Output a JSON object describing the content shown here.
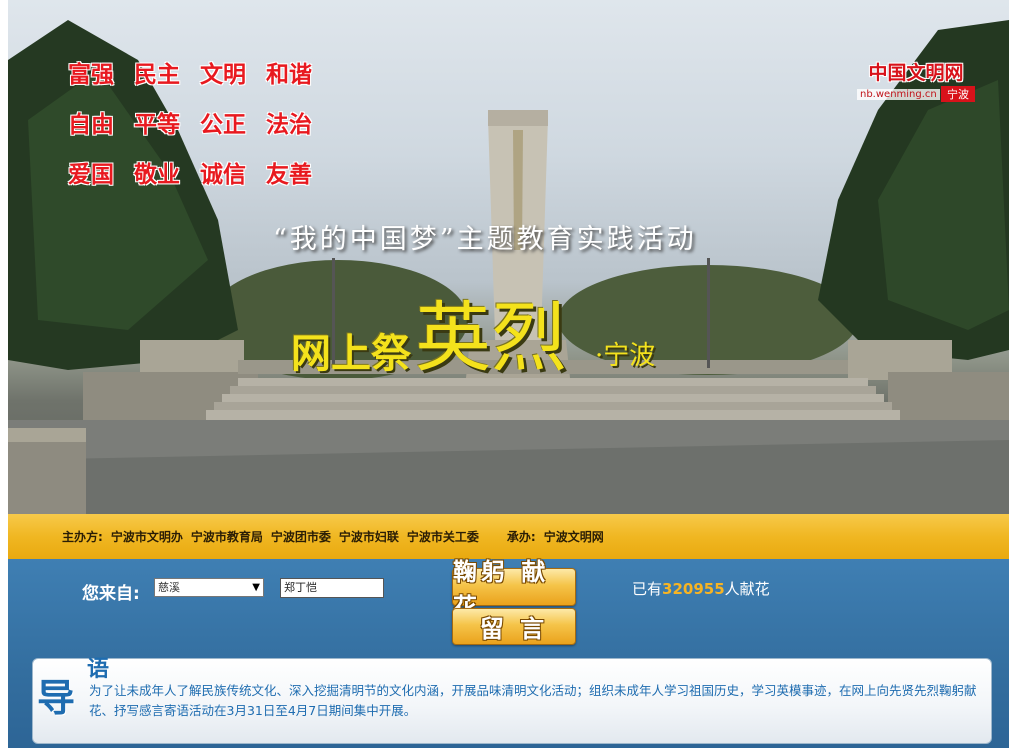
{
  "banner": {
    "values": [
      "富强",
      "民主",
      "文明",
      "和谐",
      "自由",
      "平等",
      "公正",
      "法治",
      "爱国",
      "敬业",
      "诚信",
      "友善"
    ],
    "logo": {
      "name": "中国文明网",
      "url": "nb.wenming.cn",
      "city": "宁波"
    },
    "theme": "“我的中国梦”主题教育实践活动",
    "headline": {
      "part1": "网上祭",
      "part2": "英烈",
      "part3": "·宁波"
    }
  },
  "sponsor": {
    "host_label": "主办方:",
    "hosts": [
      "宁波市文明办",
      "宁波市教育局",
      "宁波团市委",
      "宁波市妇联",
      "宁波市关工委"
    ],
    "organizer_label": "承办:",
    "organizer": "宁波文明网"
  },
  "form": {
    "from_label": "您来自:",
    "from_selected": "慈溪",
    "name_value": "郑丁恺",
    "flower_button": "鞠躬 献花",
    "message_button": "留 言",
    "count_prefix": "已有",
    "count_value": "320955",
    "count_suffix": "人献花"
  },
  "intro": {
    "title_big": "导",
    "title_small": "语",
    "text": "为了让未成年人了解民族传统文化、深入挖掘清明节的文化内涵，开展品味清明文化活动；组织未成年人学习祖国历史，学习英模事迹，在网上向先贤先烈鞠躬献花、抒写感言寄语活动在3月31日至4月7日期间集中开展。"
  },
  "colors": {
    "values_red": "#e8191f",
    "headline_yellow": "#f4e21c",
    "sponsor_bar": "#f0b722",
    "panel_blue": "#336e9f",
    "count_orange": "#f7b423",
    "intro_blue": "#1e6cb0"
  }
}
